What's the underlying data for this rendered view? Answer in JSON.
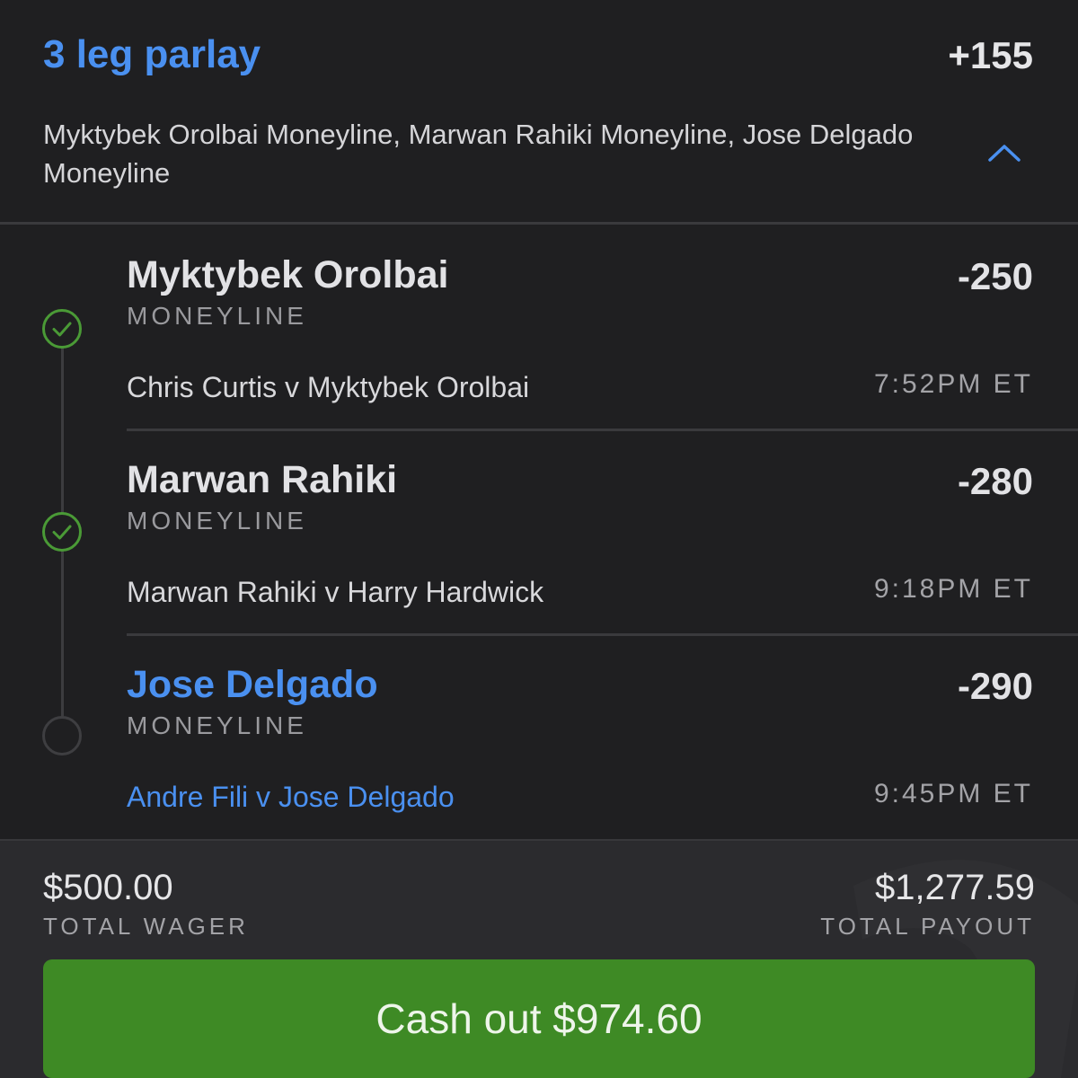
{
  "parlay": {
    "title": "3 leg parlay",
    "odds": "+155",
    "summary": "Myktybek Orolbai Moneyline, Marwan Rahiki Moneyline, Jose Delgado Moneyline",
    "collapse_icon": "chevron-up-icon"
  },
  "legs": [
    {
      "name": "Myktybek Orolbai",
      "type": "MONEYLINE",
      "odds": "-250",
      "matchup": "Chris Curtis v Myktybek Orolbai",
      "time": "7:52PM ET",
      "status": "won",
      "status_icon": "check-circle-icon"
    },
    {
      "name": "Marwan Rahiki",
      "type": "MONEYLINE",
      "odds": "-280",
      "matchup": "Marwan Rahiki v Harry Hardwick",
      "time": "9:18PM ET",
      "status": "won",
      "status_icon": "check-circle-icon"
    },
    {
      "name": "Jose Delgado",
      "type": "MONEYLINE",
      "odds": "-290",
      "matchup": "Andre Fili v Jose Delgado",
      "time": "9:45PM ET",
      "status": "pending",
      "status_icon": "empty-circle-icon"
    }
  ],
  "footer": {
    "wager_amount": "$500.00",
    "wager_label": "TOTAL WAGER",
    "payout_amount": "$1,277.59",
    "payout_label": "TOTAL PAYOUT",
    "cashout_label": "Cash out $974.60"
  },
  "colors": {
    "accent_blue": "#4a90f0",
    "won_green": "#4a9a36",
    "cashout_green": "#3e8a25",
    "background": "#1f1f21",
    "footer_background": "#2b2b2e"
  }
}
